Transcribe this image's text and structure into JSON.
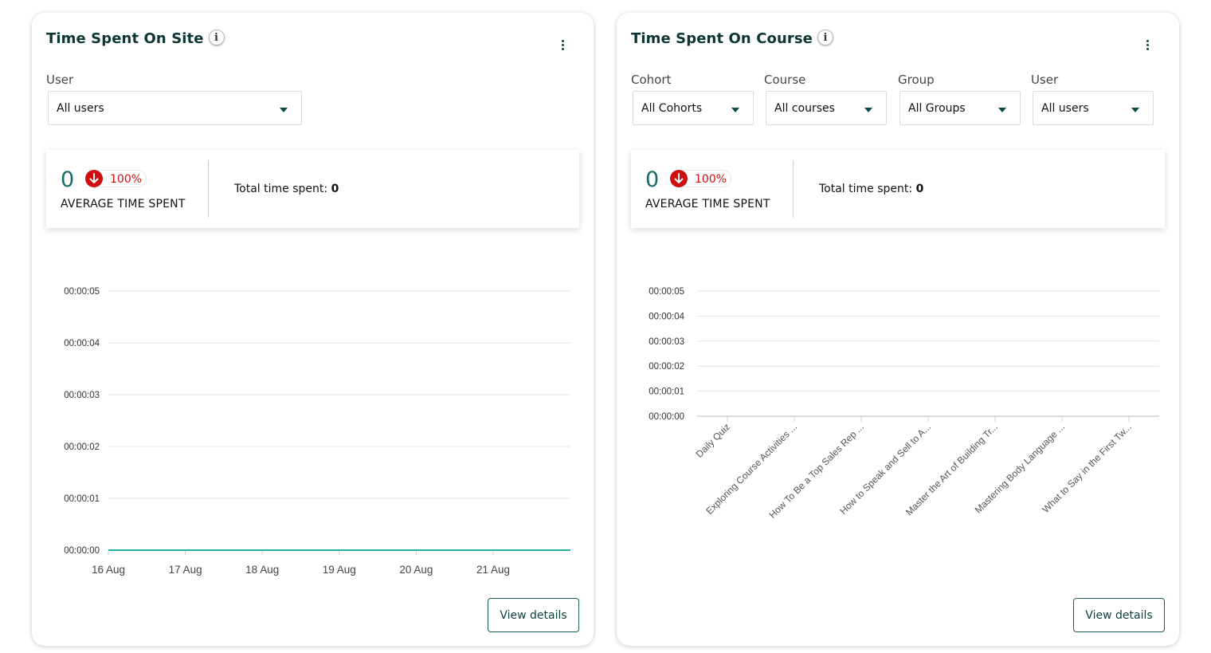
{
  "site": {
    "title": "Time Spent On Site",
    "filters": [
      {
        "label": "User",
        "value": "All users"
      }
    ],
    "kpi": {
      "value": "0",
      "change": "100%",
      "label": "AVERAGE TIME SPENT",
      "total_label": "Total time spent:",
      "total_value": "0"
    },
    "view_details": "View details"
  },
  "course": {
    "title": "Time Spent On Course",
    "filters": [
      {
        "label": "Cohort",
        "value": "All Cohorts"
      },
      {
        "label": "Course",
        "value": "All courses"
      },
      {
        "label": "Group",
        "value": "All Groups"
      },
      {
        "label": "User",
        "value": "All users"
      }
    ],
    "kpi": {
      "value": "0",
      "change": "100%",
      "label": "AVERAGE TIME SPENT",
      "total_label": "Total time spent:",
      "total_value": "0"
    },
    "view_details": "View details"
  },
  "icons": {
    "info": "info-icon",
    "menu": "kebab-menu-icon",
    "change": "arrow-down-icon",
    "dropdown": "caret-down-icon"
  },
  "colors": {
    "accent": "#1a6b68",
    "line": "#22b2aa",
    "negative": "#cc1010"
  },
  "chart_data": [
    {
      "type": "line",
      "x": [
        "16 Aug",
        "17 Aug",
        "18 Aug",
        "19 Aug",
        "20 Aug",
        "21 Aug"
      ],
      "series": [
        {
          "values": [
            0,
            0,
            0,
            0,
            0,
            0
          ]
        }
      ],
      "y_ticks": [
        "00:00:00",
        "00:00:01",
        "00:00:02",
        "00:00:03",
        "00:00:04",
        "00:00:05"
      ],
      "ylim": [
        0,
        5
      ],
      "grid": true
    },
    {
      "type": "bar",
      "categories": [
        "Daily Quiz",
        "Exploring Course Activities ...",
        "How To Be a Top Sales Rep ...",
        "How to Speak and Sell to A...",
        "Master the Art of Building Tr...",
        "Mastering Body Language ...",
        "What to Say in the First Tw..."
      ],
      "values": [
        0,
        0,
        0,
        0,
        0,
        0,
        0
      ],
      "y_ticks": [
        "00:00:00",
        "00:00:01",
        "00:00:02",
        "00:00:03",
        "00:00:04",
        "00:00:05"
      ],
      "ylim": [
        0,
        5
      ],
      "grid": true
    }
  ]
}
